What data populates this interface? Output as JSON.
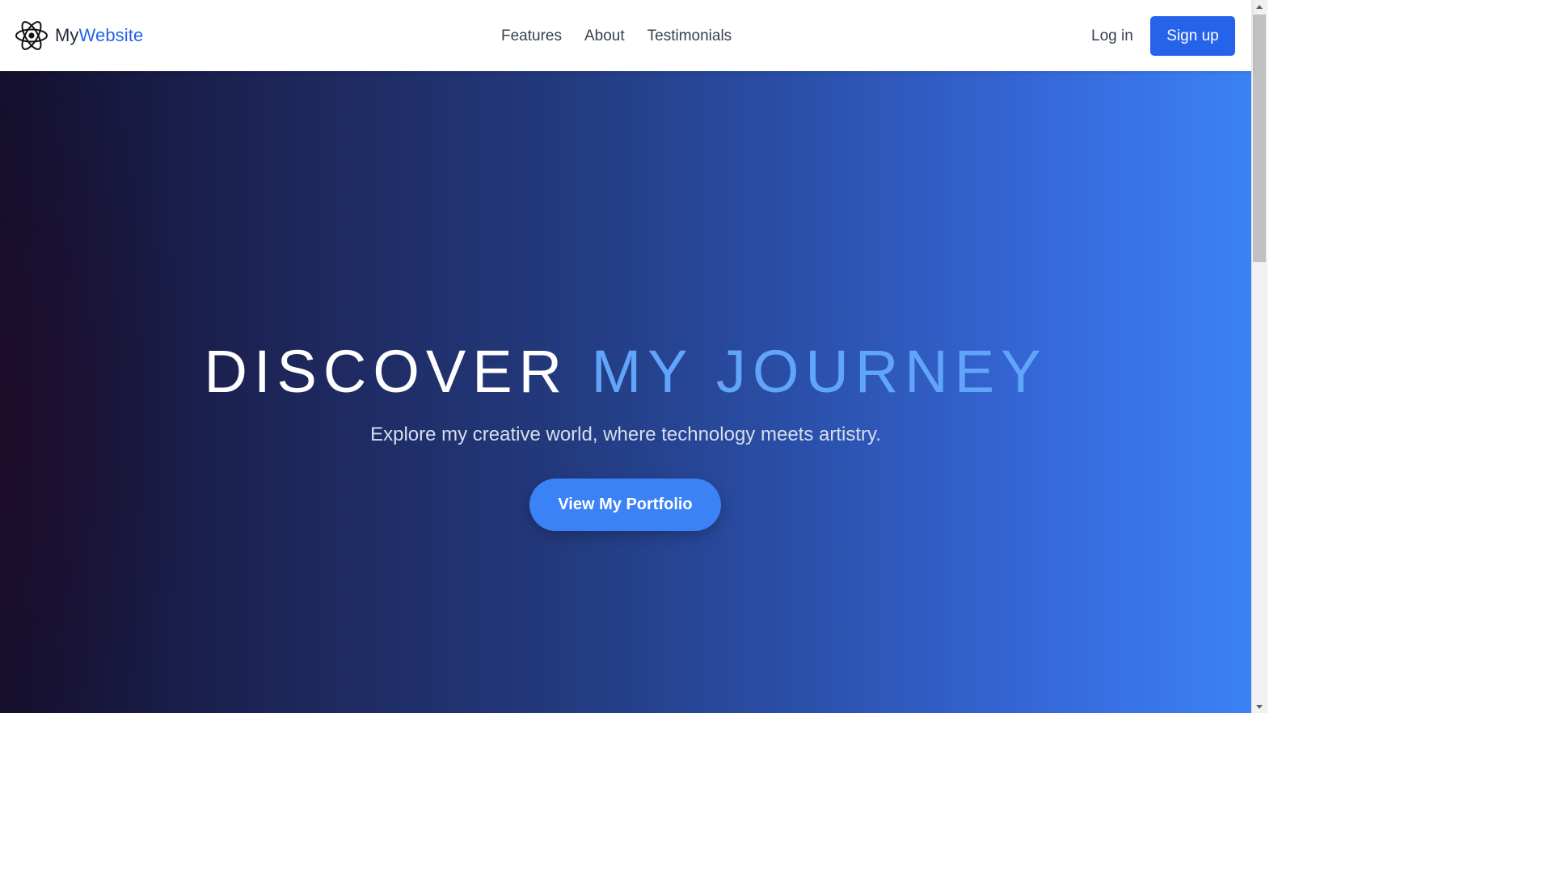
{
  "navbar": {
    "brand": {
      "icon": "atom-icon",
      "prefix": "My",
      "suffix": "Website"
    },
    "links": [
      "Features",
      "About",
      "Testimonials"
    ],
    "login_label": "Log in",
    "signup_label": "Sign up"
  },
  "hero": {
    "title_part1": "DISCOVER",
    "title_part2": "MY JOURNEY",
    "subtitle": "Explore my creative world, where technology meets artistry.",
    "cta_label": "View My Portfolio"
  },
  "colors": {
    "brand_accent": "#2563eb",
    "title_highlight": "#60a5fa",
    "cta_background": "#3b82f6",
    "hero_gradient_start": "#12102e",
    "hero_gradient_end": "#3b82f6"
  }
}
